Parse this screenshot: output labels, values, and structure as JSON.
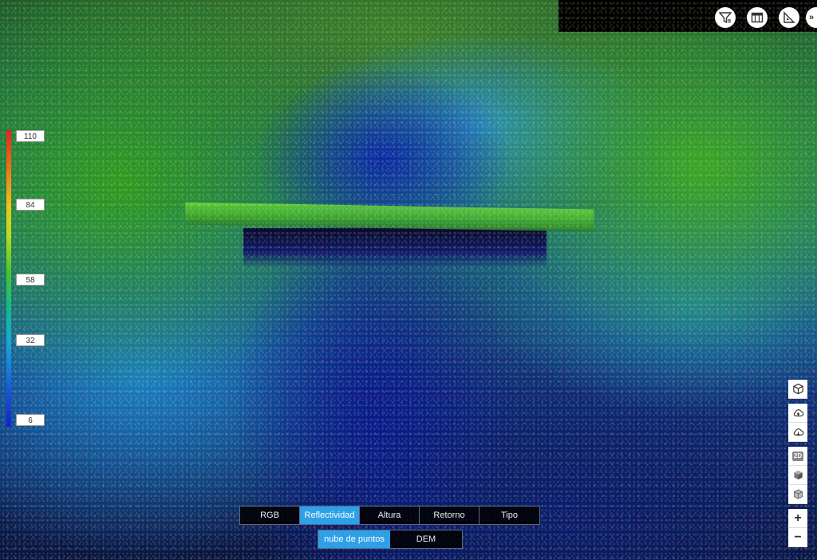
{
  "legend": {
    "ticks": [
      "110",
      "84",
      "58",
      "32",
      "6"
    ]
  },
  "top_tools": {
    "icons": [
      "filter-icon",
      "map-icon",
      "measure-icon"
    ],
    "more_label": "»"
  },
  "side_controls": {
    "view_cube": "cube-icon",
    "cloud_up": "cloud-upload-icon",
    "cloud_down": "cloud-download-icon",
    "mode_2d_label": "2D",
    "zoom_in_label": "+",
    "zoom_out_label": "−"
  },
  "color_modes": {
    "tabs": [
      "RGB",
      "Reflectividad",
      "Altura",
      "Retorno",
      "Tipo"
    ],
    "active": "Reflectividad"
  },
  "view_modes": {
    "tabs": [
      "nube de puntos",
      "DEM"
    ],
    "active": "nube de puntos"
  },
  "colors": {
    "accent": "#2ea0e8",
    "scale_top": "#e3201b",
    "scale_bottom": "#1620c8"
  }
}
